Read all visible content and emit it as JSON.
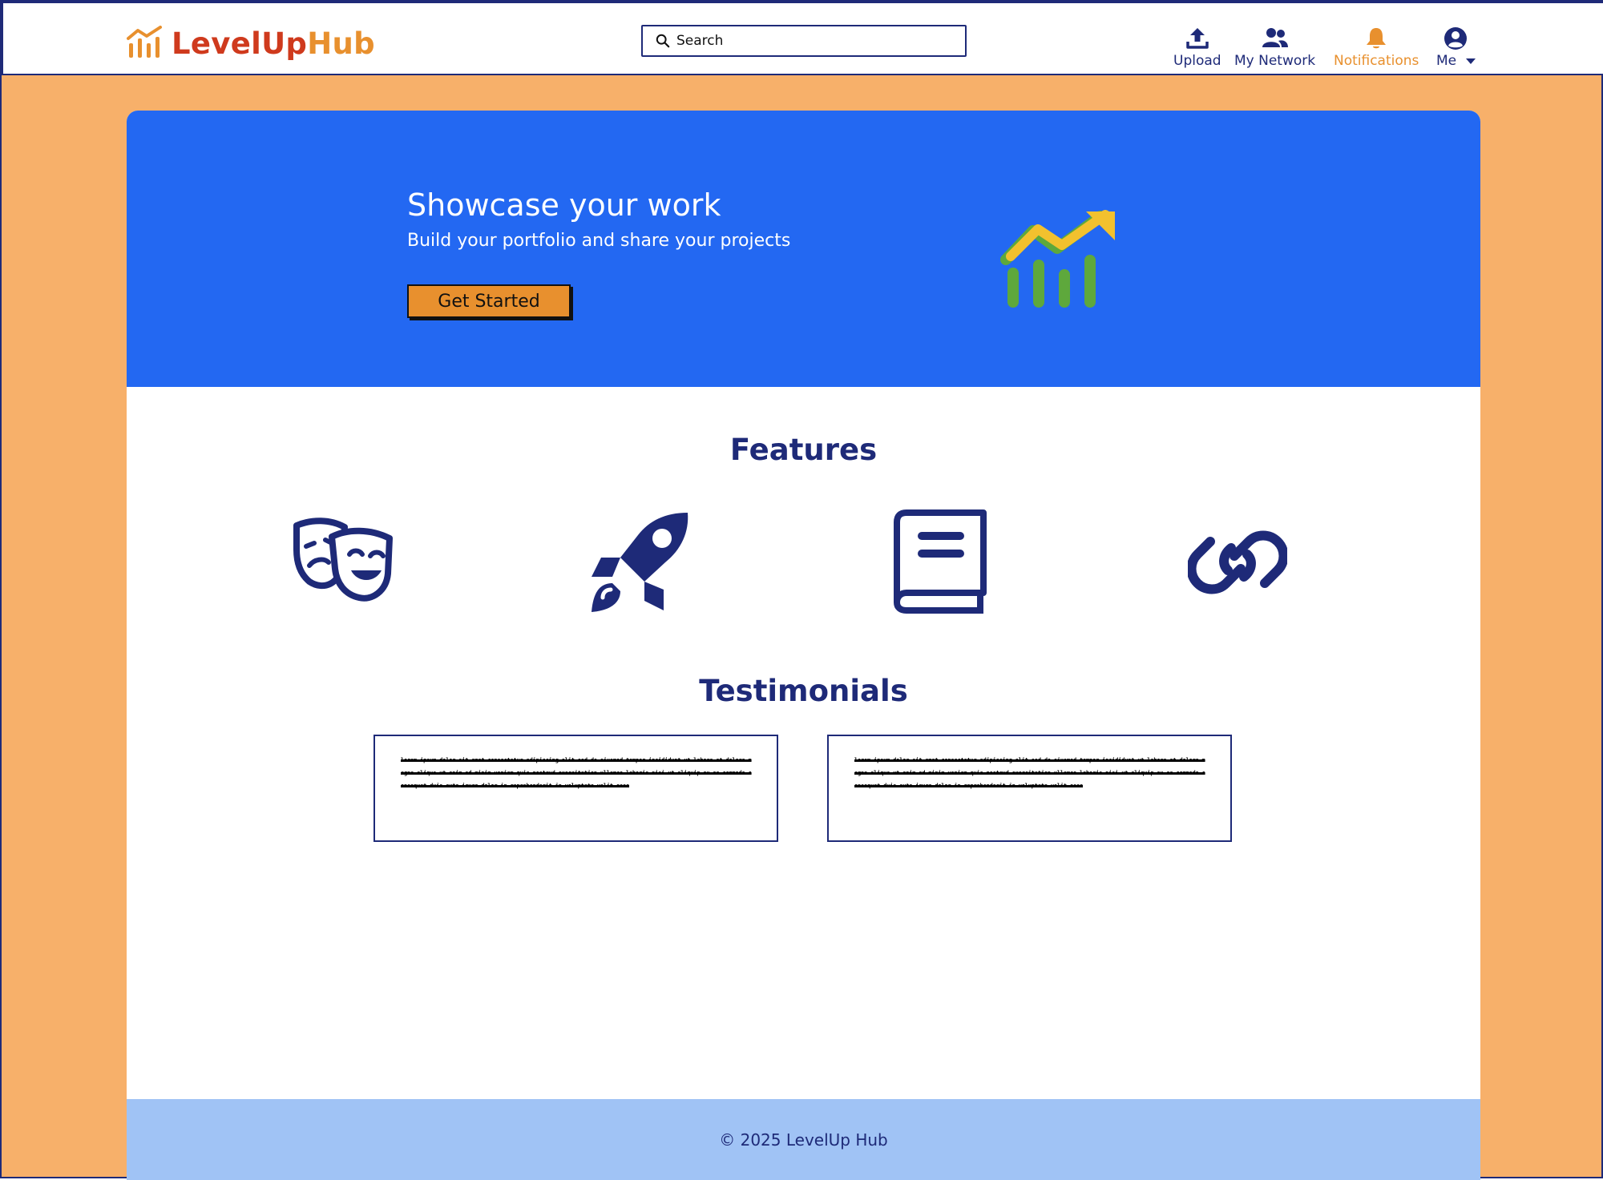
{
  "header": {
    "logo_part1": "LevelUp",
    "logo_part2": "Hub",
    "search_placeholder": "Search",
    "nav": [
      {
        "label": "Upload",
        "icon": "upload-icon"
      },
      {
        "label": "My Network",
        "icon": "users-icon"
      },
      {
        "label": "Notifications",
        "icon": "bell-icon",
        "active": true
      },
      {
        "label": "Me",
        "icon": "user-circle-icon"
      }
    ]
  },
  "hero": {
    "title": "Showcase your work",
    "subtitle": "Build your portfolio and share your projects",
    "cta_label": "Get Started",
    "illustration": "growth-chart-icon"
  },
  "features": {
    "title": "Features",
    "icons": [
      "theater-masks-icon",
      "rocket-icon",
      "book-icon",
      "link-icon"
    ]
  },
  "testimonials": {
    "title": "Testimonials",
    "items": [
      {
        "text": "lorem ipsum dolor sit amet consectetur adipiscing elit sed do eiusmod tempor incididunt ut labore et dolore magna aliqua ut enim ad minim veniam quis nostrud exercitation ullamco laboris nisi ut aliquip ex ea commodo consequat duis aute irure dolor in reprehenderit in voluptate velit esse"
      },
      {
        "text": "lorem ipsum dolor sit amet consectetur adipiscing elit sed do eiusmod tempor incididunt ut labore et dolore magna aliqua ut enim ad minim veniam quis nostrud exercitation ullamco laboris nisi ut aliquip ex ea commodo consequat duis aute irure dolor in reprehenderit in voluptate velit esse"
      }
    ]
  },
  "footer": {
    "text": "© 2025 LevelUp Hub"
  },
  "colors": {
    "navy": "#1e2a78",
    "orange": "#e8902e",
    "red": "#cf3a1d",
    "hero_blue": "#2368f2",
    "page_bg": "#f7b06a",
    "footer_bg": "#a0c3f5"
  }
}
